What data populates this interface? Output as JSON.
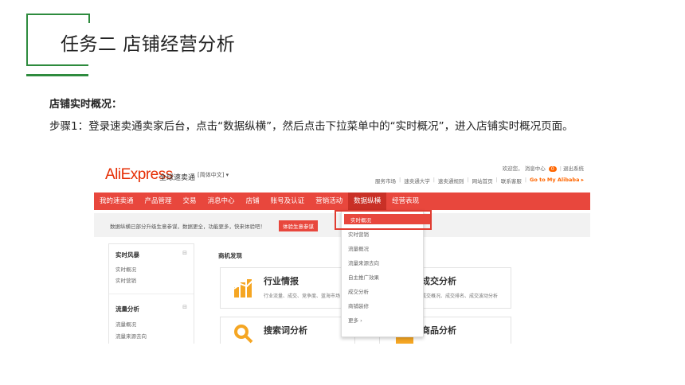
{
  "slide": {
    "title": "任务二 店铺经营分析",
    "sub_heading": "店铺实时概况：",
    "paragraph": "步骤1：登录速卖通卖家后台，点击“数据纵横”，然后点击下拉菜单中的“实时概况”，进入店铺实时概况页面。",
    "accent_color": "#2e8b3e"
  },
  "screenshot": {
    "logo": "AliExpress",
    "logo_cn": "全球速卖通",
    "language": "[简体中文] ▾",
    "welcome": "欢迎您，",
    "message_center": "消息中心",
    "message_count": "0",
    "logout": "退出系统",
    "top_links": [
      "服务市场",
      "速卖通大学",
      "速卖通规则",
      "网站首页",
      "联系客服",
      "Go to My Alibaba ▸"
    ],
    "nav": [
      "我的速卖通",
      "产品管理",
      "交易",
      "消息中心",
      "店铺",
      "账号及认证",
      "营销活动",
      "数据纵横",
      "经营表现"
    ],
    "active_nav": "数据纵横",
    "notice": "数据纵横已部分升级生意参谋，数据更全，功能更多，快来体验吧！",
    "notice_button": "体验生意参谋",
    "sidebar": {
      "section1": "实时风暴",
      "section1_links": [
        "实时概况",
        "实时营销"
      ],
      "section2": "流量分析",
      "section2_links": [
        "流量概况",
        "流量来源去向"
      ],
      "toggle_symbol": "⊟"
    },
    "main": {
      "heading": "商机发现",
      "cards": [
        {
          "title": "行业情报",
          "desc": "行业流量、成交、竞争度、蓝海市场"
        },
        {
          "title": "成交分析",
          "desc": "成交概况、成交排名、成交波动分析"
        },
        {
          "title": "搜索词分析",
          "desc": ""
        },
        {
          "title": "商品分析",
          "desc": ""
        }
      ]
    },
    "dropdown": {
      "active": "实时概况",
      "items": [
        "实时营销",
        "流量概况",
        "流量来源去向",
        "自主推广效果",
        "成交分析",
        "商铺装修",
        "更多 ›"
      ]
    }
  }
}
